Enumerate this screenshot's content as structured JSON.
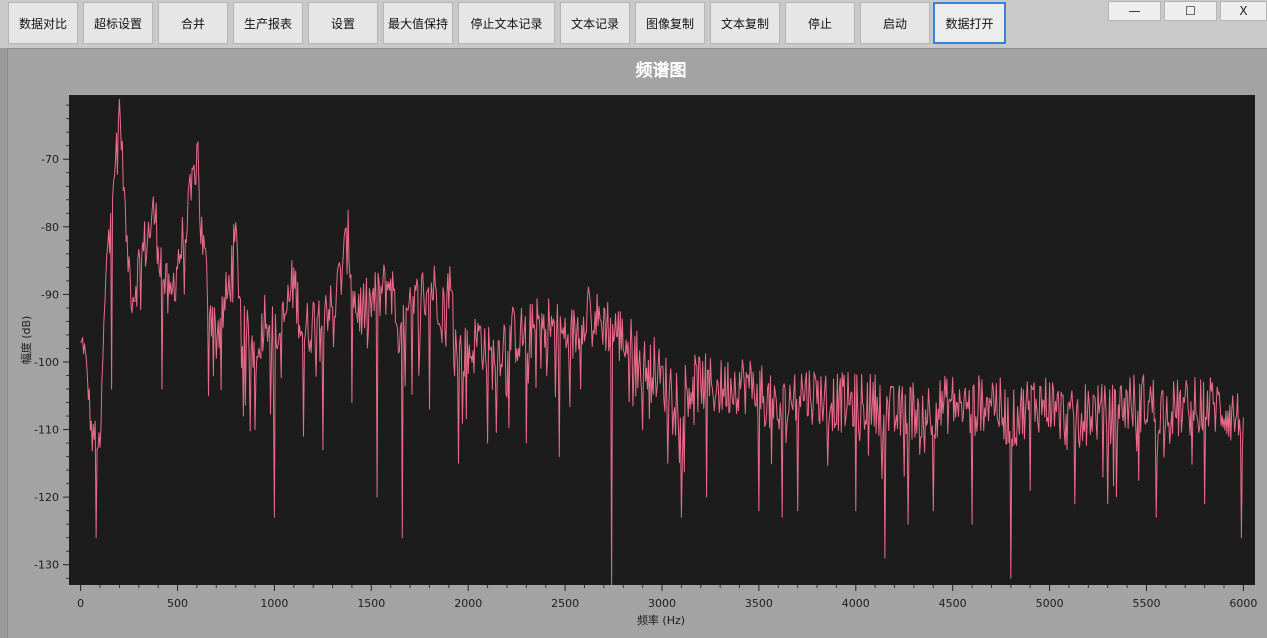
{
  "toolbar": {
    "buttons": [
      {
        "label": "数据对比"
      },
      {
        "label": "超标设置"
      },
      {
        "label": "合并"
      },
      {
        "label": "生产报表"
      },
      {
        "label": "设置"
      },
      {
        "label": "最大值保持"
      },
      {
        "label": "停止文本记录"
      },
      {
        "label": "文本记录"
      },
      {
        "label": "图像复制"
      },
      {
        "label": "文本复制"
      },
      {
        "label": "停止"
      },
      {
        "label": "启动"
      },
      {
        "label": "数据打开"
      }
    ],
    "active_index": 12
  },
  "window_controls": {
    "minimize": "—",
    "maximize": "☐",
    "close": "X"
  },
  "colors": {
    "plot_background": "#1c1c1c",
    "series": "#e96b8a",
    "toolbar_active_border": "#3b7fd4"
  },
  "chart_data": {
    "type": "line",
    "title": "频谱图",
    "xlabel": "频率 (Hz)",
    "ylabel": "幅度 (dB)",
    "xlim": [
      -60,
      6060
    ],
    "ylim": [
      -133,
      -60.5
    ],
    "x_ticks": [
      0,
      500,
      1000,
      1500,
      2000,
      2500,
      3000,
      3500,
      4000,
      4500,
      5000,
      5500,
      6000
    ],
    "y_ticks": [
      -130,
      -120,
      -110,
      -100,
      -90,
      -80,
      -70
    ],
    "series": [
      {
        "anchors": [
          [
            0,
            -98
          ],
          [
            15,
            -97
          ],
          [
            40,
            -104
          ],
          [
            60,
            -112
          ],
          [
            80,
            -110
          ],
          [
            100,
            -114
          ],
          [
            120,
            -95
          ],
          [
            140,
            -82
          ],
          [
            160,
            -74
          ],
          [
            180,
            -70
          ],
          [
            200,
            -62
          ],
          [
            220,
            -72
          ],
          [
            240,
            -84
          ],
          [
            270,
            -90
          ],
          [
            300,
            -86
          ],
          [
            340,
            -82
          ],
          [
            380,
            -78
          ],
          [
            420,
            -86
          ],
          [
            460,
            -92
          ],
          [
            500,
            -85
          ],
          [
            540,
            -81
          ],
          [
            580,
            -74
          ],
          [
            600,
            -66
          ],
          [
            620,
            -80
          ],
          [
            660,
            -90
          ],
          [
            700,
            -96
          ],
          [
            760,
            -90
          ],
          [
            800,
            -82
          ],
          [
            840,
            -96
          ],
          [
            900,
            -98
          ],
          [
            960,
            -92
          ],
          [
            1000,
            -97
          ],
          [
            1040,
            -95
          ],
          [
            1100,
            -88
          ],
          [
            1150,
            -96
          ],
          [
            1200,
            -94
          ],
          [
            1250,
            -90
          ],
          [
            1300,
            -93
          ],
          [
            1350,
            -86
          ],
          [
            1380,
            -82
          ],
          [
            1420,
            -92
          ],
          [
            1480,
            -92
          ],
          [
            1550,
            -90
          ],
          [
            1600,
            -88
          ],
          [
            1650,
            -97
          ],
          [
            1700,
            -93
          ],
          [
            1760,
            -90
          ],
          [
            1820,
            -89
          ],
          [
            1880,
            -92
          ],
          [
            1900,
            -88
          ],
          [
            1950,
            -98
          ],
          [
            2000,
            -99
          ],
          [
            2060,
            -96
          ],
          [
            2120,
            -100
          ],
          [
            2200,
            -96
          ],
          [
            2300,
            -96
          ],
          [
            2400,
            -94
          ],
          [
            2480,
            -96
          ],
          [
            2550,
            -96
          ],
          [
            2620,
            -91
          ],
          [
            2660,
            -94
          ],
          [
            2700,
            -94
          ],
          [
            2780,
            -96
          ],
          [
            2850,
            -98
          ],
          [
            2900,
            -101
          ],
          [
            2950,
            -100
          ],
          [
            3000,
            -103
          ],
          [
            3100,
            -104
          ],
          [
            3200,
            -103
          ],
          [
            3300,
            -104
          ],
          [
            3400,
            -103
          ],
          [
            3500,
            -104
          ],
          [
            3600,
            -108
          ],
          [
            3700,
            -104
          ],
          [
            3800,
            -105
          ],
          [
            3900,
            -106
          ],
          [
            4000,
            -106
          ],
          [
            4100,
            -106
          ],
          [
            4200,
            -108
          ],
          [
            4300,
            -107
          ],
          [
            4400,
            -107
          ],
          [
            4500,
            -106
          ],
          [
            4600,
            -107
          ],
          [
            4700,
            -105
          ],
          [
            4800,
            -109
          ],
          [
            4900,
            -106
          ],
          [
            5000,
            -106
          ],
          [
            5100,
            -109
          ],
          [
            5200,
            -107
          ],
          [
            5300,
            -108
          ],
          [
            5400,
            -106
          ],
          [
            5500,
            -106
          ],
          [
            5600,
            -107
          ],
          [
            5700,
            -107
          ],
          [
            5800,
            -106
          ],
          [
            5900,
            -107
          ],
          [
            6000,
            -109
          ]
        ],
        "spikes": [
          [
            80,
            -126
          ],
          [
            160,
            -104
          ],
          [
            420,
            -104
          ],
          [
            660,
            -105
          ],
          [
            840,
            -108
          ],
          [
            900,
            -110
          ],
          [
            1000,
            -123
          ],
          [
            1150,
            -111
          ],
          [
            1250,
            -113
          ],
          [
            1400,
            -106
          ],
          [
            1530,
            -120
          ],
          [
            1660,
            -126
          ],
          [
            1800,
            -107
          ],
          [
            1950,
            -115
          ],
          [
            2100,
            -112
          ],
          [
            2300,
            -112
          ],
          [
            2470,
            -114
          ],
          [
            2580,
            -104
          ],
          [
            2740,
            -133
          ],
          [
            2900,
            -110
          ],
          [
            3030,
            -115
          ],
          [
            3100,
            -123
          ],
          [
            3230,
            -120
          ],
          [
            3500,
            -122
          ],
          [
            3620,
            -123
          ],
          [
            3700,
            -122
          ],
          [
            4000,
            -122
          ],
          [
            4150,
            -129
          ],
          [
            4270,
            -124
          ],
          [
            4400,
            -122
          ],
          [
            4600,
            -124
          ],
          [
            4800,
            -132
          ],
          [
            4900,
            -119
          ],
          [
            5130,
            -121
          ],
          [
            5300,
            -121
          ],
          [
            5550,
            -123
          ],
          [
            5800,
            -121
          ],
          [
            5990,
            -126
          ]
        ],
        "noise_amplitude": 4.5
      }
    ]
  }
}
